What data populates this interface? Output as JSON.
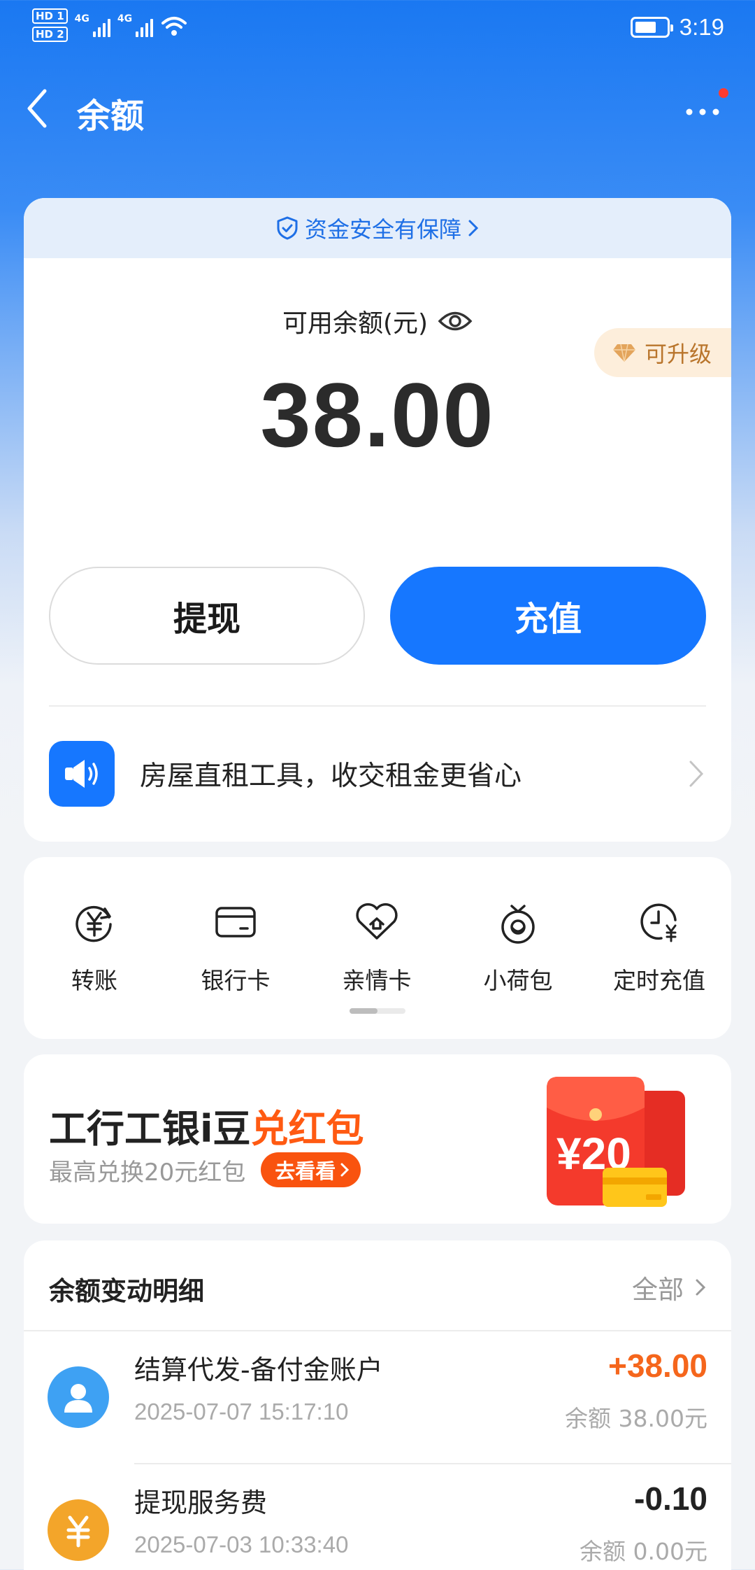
{
  "status_bar": {
    "hd1": "HD 1",
    "hd2": "HD 2",
    "net1": "4G",
    "net2": "4G",
    "time": "3:19"
  },
  "header": {
    "title": "余额"
  },
  "safety": {
    "text": "资金安全有保障"
  },
  "balance": {
    "label": "可用余额(元)",
    "amount": "38.00",
    "upgrade": "可升级"
  },
  "actions": {
    "withdraw": "提现",
    "recharge": "充值"
  },
  "promo": {
    "text": "房屋直租工具，收交租金更省心"
  },
  "services": [
    {
      "label": "转账",
      "icon": "transfer-icon"
    },
    {
      "label": "银行卡",
      "icon": "bank-card-icon"
    },
    {
      "label": "亲情卡",
      "icon": "family-card-icon"
    },
    {
      "label": "小荷包",
      "icon": "pouch-icon"
    },
    {
      "label": "定时充值",
      "icon": "scheduled-recharge-icon"
    }
  ],
  "bean": {
    "title_prefix": "工行工银i豆",
    "title_highlight": "兑红包",
    "subtitle": "最高兑换20元红包",
    "button": "去看看",
    "redpack_amount": "¥20"
  },
  "details": {
    "title": "余额变动明细",
    "all_label": "全部",
    "transactions": [
      {
        "name": "结算代发-备付金账户",
        "time": "2025-07-07 15:17:10",
        "amount": "+38.00",
        "balance": "余额 38.00元",
        "color": "#f5661c"
      },
      {
        "name": "提现服务费",
        "time": "2025-07-03 10:33:40",
        "amount": "-0.10",
        "balance": "余额 0.00元",
        "color": "#222222"
      }
    ]
  },
  "colors": {
    "primary": "#1677ff",
    "accent_orange": "#f5661c",
    "upgrade_gold": "#b9752c"
  }
}
